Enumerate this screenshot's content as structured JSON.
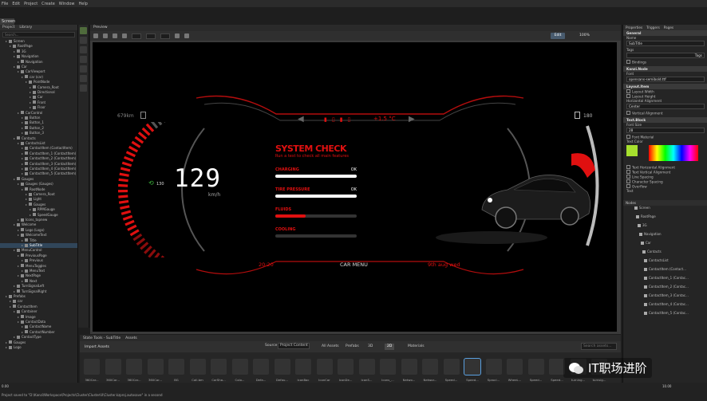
{
  "menu": [
    "File",
    "Edit",
    "Project",
    "Create",
    "Window",
    "Help"
  ],
  "screen_tab": "Screen",
  "left_panel": {
    "tabs": [
      "Project",
      "Library"
    ],
    "search_placeholder": "Search...",
    "tree": [
      {
        "label": "Screen",
        "depth": 1
      },
      {
        "label": "RootPage",
        "depth": 2
      },
      {
        "label": "3G",
        "depth": 3
      },
      {
        "label": "Navigation",
        "depth": 3
      },
      {
        "label": "Navigation",
        "depth": 4
      },
      {
        "label": "Car",
        "depth": 3
      },
      {
        "label": "CarViewport",
        "depth": 4
      },
      {
        "label": "car (car)",
        "depth": 5
      },
      {
        "label": "PointNode",
        "depth": 6
      },
      {
        "label": "Camera_Root",
        "depth": 7
      },
      {
        "label": "Directional",
        "depth": 7
      },
      {
        "label": "Car",
        "depth": 7
      },
      {
        "label": "Front",
        "depth": 7
      },
      {
        "label": "Floor",
        "depth": 7
      },
      {
        "label": "CarControl",
        "depth": 4
      },
      {
        "label": "Button",
        "depth": 5
      },
      {
        "label": "Button_1",
        "depth": 5
      },
      {
        "label": "Button_2",
        "depth": 5
      },
      {
        "label": "Button_3",
        "depth": 5
      },
      {
        "label": "Contacts",
        "depth": 3
      },
      {
        "label": "ContactsList",
        "depth": 4
      },
      {
        "label": "ContactItem (ContactItem)",
        "depth": 5
      },
      {
        "label": "ContactItem_1 (ContactItem)",
        "depth": 5
      },
      {
        "label": "ContactItem_2 (ContactItem)",
        "depth": 5
      },
      {
        "label": "ContactItem_3 (ContactItem)",
        "depth": 5
      },
      {
        "label": "ContactItem_4 (ContactItem)",
        "depth": 5
      },
      {
        "label": "ContactItem_5 (ContactItem)",
        "depth": 5
      },
      {
        "label": "Gauges",
        "depth": 3
      },
      {
        "label": "Gauges (Gauges)",
        "depth": 4
      },
      {
        "label": "RootNode",
        "depth": 5
      },
      {
        "label": "Camera_Root",
        "depth": 6
      },
      {
        "label": "Light",
        "depth": 6
      },
      {
        "label": "Gauges",
        "depth": 6
      },
      {
        "label": "RPMGauge",
        "depth": 7
      },
      {
        "label": "SpeedGauge",
        "depth": 7
      },
      {
        "label": "Icons_topnew",
        "depth": 4
      },
      {
        "label": "Welcome",
        "depth": 3
      },
      {
        "label": "Logo (Logo)",
        "depth": 4
      },
      {
        "label": "WelcomeText",
        "depth": 4
      },
      {
        "label": "Title",
        "depth": 5
      },
      {
        "label": "SubTitle",
        "depth": 5
      },
      {
        "label": "MenuControl",
        "depth": 3
      },
      {
        "label": "PreviousPage",
        "depth": 4
      },
      {
        "label": "Previous",
        "depth": 5
      },
      {
        "label": "MenuToggles",
        "depth": 4
      },
      {
        "label": "MenuText",
        "depth": 5
      },
      {
        "label": "NextPage",
        "depth": 4
      },
      {
        "label": "Next",
        "depth": 5
      },
      {
        "label": "TurnSignalLeft",
        "depth": 3
      },
      {
        "label": "TurnSignalRight",
        "depth": 3
      },
      {
        "label": "Prefabs",
        "depth": 1
      },
      {
        "label": "car",
        "depth": 2
      },
      {
        "label": "ContactItem",
        "depth": 2
      },
      {
        "label": "Container",
        "depth": 3
      },
      {
        "label": "Image",
        "depth": 4
      },
      {
        "label": "ContactData",
        "depth": 4
      },
      {
        "label": "ContactName",
        "depth": 5
      },
      {
        "label": "ContactNumber",
        "depth": 5
      },
      {
        "label": "ContactType",
        "depth": 3
      },
      {
        "label": "Gauges",
        "depth": 1
      },
      {
        "label": "Logo",
        "depth": 1
      }
    ],
    "selected_index": 40
  },
  "preview": {
    "tab": "Preview",
    "fit_label": "Edit",
    "zoom": "100%"
  },
  "dashboard": {
    "fuel_left": "679km",
    "fuel_right": "180",
    "status_temp": "+1.5 °C",
    "speed": "129",
    "speed_unit": "km/h",
    "speed_limit": "130",
    "system_check_title": "SYSTEM CHECK",
    "system_check_sub": "Run a test to check all main features",
    "checks": [
      {
        "label": "CHARGING",
        "status": "OK",
        "fill": 1.0,
        "color": "#ffffff"
      },
      {
        "label": "TIRE PRESSURE",
        "status": "OK",
        "fill": 1.0,
        "color": "#ffffff"
      },
      {
        "label": "FLUIDS",
        "status": "",
        "fill": 0.37,
        "color": "#e01010"
      },
      {
        "label": "COOLING",
        "status": "",
        "fill": 0.0,
        "color": "#e01010"
      }
    ],
    "time": "20:20",
    "menu_label": "CAR MENU",
    "date": "9th aug wed"
  },
  "bottom_tabs": [
    "State Tools - SubTitle",
    "Assets"
  ],
  "assets": {
    "import_label": "Import Assets",
    "source_label": "Source",
    "source_value": "Project Content",
    "filter_tabs": [
      "All Assets",
      "Prefabs",
      "3D",
      "2D",
      "Materials"
    ],
    "selected_filter": 3,
    "search_placeholder": "Search assets...",
    "items": [
      "360Car...",
      "360Car...",
      "360Car...",
      "360Car...",
      "BG",
      "Call.bm",
      "CarSha...",
      "Colo...",
      "Defa...",
      "Defau...",
      "IconBac",
      "IconCar",
      "IconDe...",
      "IconS...",
      "Icons_...",
      "Netwo...",
      "Networ...",
      "Speed...",
      "Speed...",
      "Sprocl...",
      "WheeL...",
      "Speed...",
      "Speed...",
      "turning...",
      "turnsig..."
    ],
    "selected_item": 18
  },
  "right_panel": {
    "tabs": [
      "Properties",
      "Triggers",
      "Pages"
    ],
    "general_label": "General",
    "name_label": "Name",
    "name_value": "SubTitle",
    "tags_label": "Tags",
    "tags_btn": "Tags",
    "bindings_label": "Bindings",
    "kanzi_node": "Kanzi.Node",
    "font_label": "Font",
    "font_value": "opensans-semibold.ttf",
    "layout_item": "Layout.Item",
    "checks1": [
      "Layout Width",
      "Layout Height"
    ],
    "halign_label": "Horizontal Alignment",
    "halign_value": "Center",
    "valign_label": "Vertical Alignment",
    "text_block": "Text.Block",
    "font_size_label": "Font Size",
    "font_size_value": "28",
    "font_material": "Font Material",
    "text_color": "Text Color",
    "checks2": [
      "Text Horizontal Alignment",
      "Text Vertical Alignment",
      "Line Spacing",
      "Character Spacing",
      "Overflow"
    ],
    "text_label": "Text",
    "nodes_tab": "Nodes",
    "node_rows": [
      "Screen",
      "RootPage",
      "3G",
      "Navigation",
      "Car",
      "Contacts",
      "ContactsList",
      "ContactItem (Contact...",
      "ContactItem_1 (Contac...",
      "ContactItem_2 (Contac...",
      "ContactItem_3 (Contac...",
      "ContactItem_4 (Contac...",
      "ContactItem_5 (Contac..."
    ]
  },
  "status_text": "Project saved to \"D:\\Kanzi\\Workspace\\Projects\\Cluster\\ClusterUI\\Cluster.kzproj.autosave\" in a second",
  "timeline": {
    "left": "0.00",
    "right": "10.00"
  },
  "watermark": "IT职场进阶",
  "colors": {
    "accent_red": "#e01010",
    "bg_dark": "#1e1e1e"
  }
}
